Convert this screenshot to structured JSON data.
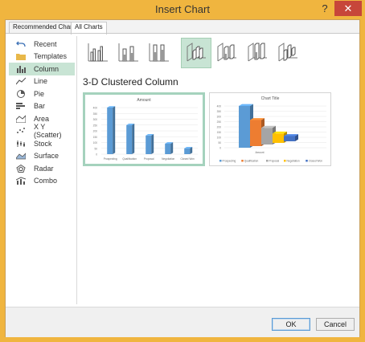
{
  "window": {
    "title": "Insert Chart",
    "help_glyph": "?",
    "close_glyph": "✕"
  },
  "tabs": [
    {
      "label": "Recommended Charts"
    },
    {
      "label": "All Charts"
    }
  ],
  "sidebar": {
    "items": [
      {
        "label": "Recent",
        "icon": "undo-arrow-icon"
      },
      {
        "label": "Templates",
        "icon": "folder-icon"
      },
      {
        "label": "Column",
        "icon": "column-chart-icon"
      },
      {
        "label": "Line",
        "icon": "line-chart-icon"
      },
      {
        "label": "Pie",
        "icon": "pie-chart-icon"
      },
      {
        "label": "Bar",
        "icon": "bar-chart-icon"
      },
      {
        "label": "Area",
        "icon": "area-chart-icon"
      },
      {
        "label": "X Y (Scatter)",
        "icon": "scatter-chart-icon"
      },
      {
        "label": "Stock",
        "icon": "stock-chart-icon"
      },
      {
        "label": "Surface",
        "icon": "surface-chart-icon"
      },
      {
        "label": "Radar",
        "icon": "radar-chart-icon"
      },
      {
        "label": "Combo",
        "icon": "combo-chart-icon"
      }
    ],
    "selected_label": "Column"
  },
  "subtypes": {
    "selected": "3-D Clustered Column",
    "icons": [
      "clustered-column-icon",
      "stacked-column-icon",
      "100-stacked-column-icon",
      "3d-clustered-column-icon",
      "3d-stacked-column-icon",
      "3d-100-stacked-column-icon",
      "3d-column-icon"
    ]
  },
  "section_title": "3-D Clustered Column",
  "chart_data": [
    {
      "type": "bar",
      "title": "Amount",
      "categories": [
        "Prospecting",
        "Qualification",
        "Proposal",
        "Negotiation",
        "Closed Won"
      ],
      "values": [
        400,
        250,
        160,
        90,
        50
      ],
      "ylim": [
        0,
        400
      ],
      "yticks": [
        "400",
        "350",
        "300",
        "250",
        "200",
        "150",
        "100",
        "50",
        "0"
      ],
      "color": "#5b9bd5",
      "legend": "none"
    },
    {
      "type": "bar",
      "title": "Chart Title",
      "categories": [
        "Amount"
      ],
      "series": [
        {
          "name": "Prospecting",
          "values": [
            400
          ],
          "color": "#5b9bd5"
        },
        {
          "name": "Qualification",
          "values": [
            250
          ],
          "color": "#ed7d31"
        },
        {
          "name": "Proposal",
          "values": [
            160
          ],
          "color": "#a5a5a5"
        },
        {
          "name": "Negotiation",
          "values": [
            90
          ],
          "color": "#ffc000"
        },
        {
          "name": "Closed Won",
          "values": [
            50
          ],
          "color": "#4472c4"
        }
      ],
      "ylim": [
        0,
        400
      ],
      "yticks": [
        "400",
        "350",
        "300",
        "250",
        "200",
        "150",
        "100",
        "50",
        "0"
      ],
      "legend": "bottom"
    }
  ],
  "footer": {
    "ok_label": "OK",
    "cancel_label": "Cancel"
  }
}
